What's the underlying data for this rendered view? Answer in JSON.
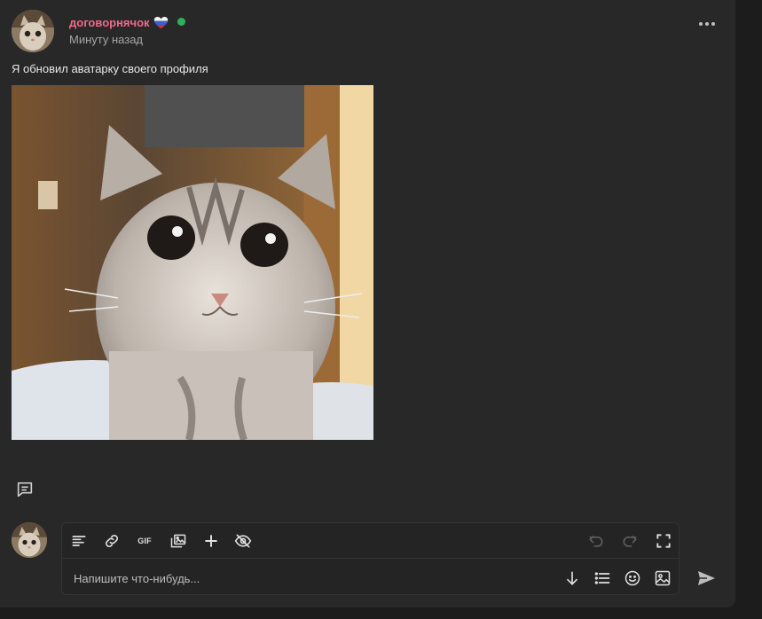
{
  "post": {
    "username": "договорнячок",
    "timestamp": "Минуту назад",
    "text": "Я обновил аватарку своего профиля"
  },
  "colors": {
    "username": "#f1698a",
    "online": "#2fb15a",
    "background": "#282828",
    "icon": "#e0e0e0",
    "icon_disabled": "#5e5e5e"
  },
  "editor": {
    "toolbar": {
      "format_icon": "align-left-icon",
      "link_icon": "link-icon",
      "gif_label": "GIF",
      "gallery_icon": "gallery-icon",
      "add_icon": "plus-icon",
      "spoiler_icon": "eye-off-icon",
      "undo_icon": "undo-icon",
      "redo_icon": "redo-icon",
      "fullscreen_icon": "fullscreen-icon"
    },
    "placeholder": "Напишите что-нибудь..."
  }
}
